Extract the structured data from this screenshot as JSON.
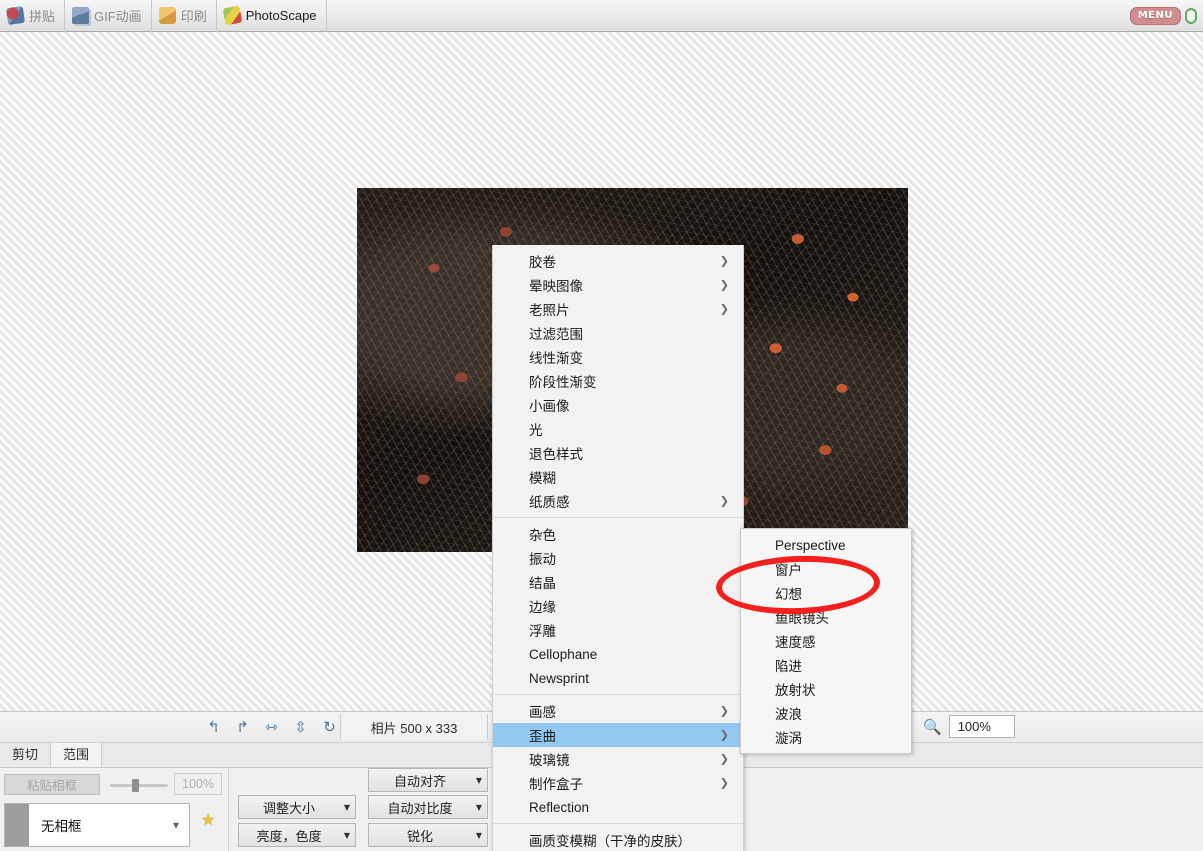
{
  "topbar": {
    "tabs": [
      {
        "label": "拼贴",
        "icon": "collage-icon",
        "active": false
      },
      {
        "label": "GIF动画",
        "icon": "gif-icon",
        "active": false
      },
      {
        "label": "印刷",
        "icon": "print-icon",
        "active": false
      },
      {
        "label": "PhotoScape",
        "icon": "photoscape-icon",
        "active": true
      }
    ],
    "menu_button": "MENU"
  },
  "canvas": {
    "photo_alt": "fishing-nets-and-floats-photo"
  },
  "toolbar": {
    "icons": [
      {
        "name": "undo-icon",
        "glyph": "↰"
      },
      {
        "name": "redo-icon",
        "glyph": "↱"
      },
      {
        "name": "flip-horizontal-icon",
        "glyph": "⇿"
      },
      {
        "name": "flip-vertical-icon",
        "glyph": "⇳"
      },
      {
        "name": "rotate-icon",
        "glyph": "↻"
      }
    ],
    "size_label": "相片 500 x 333",
    "zoom_icon": "zoom-icon",
    "zoom_value": "100%"
  },
  "subtabs": [
    {
      "label": "剪切",
      "active": false
    },
    {
      "label": "范围",
      "active": true
    }
  ],
  "panel": {
    "paste_frame_button": "粘贴相框",
    "slider_percent": "100%",
    "frame_select_value": "无相框",
    "favorite_icon": "star-icon",
    "buttons": [
      {
        "label": "调整大小",
        "dropdown": true
      },
      {
        "label": "亮度，色度",
        "dropdown": true
      },
      {
        "label": "自动对齐",
        "dropdown": true
      },
      {
        "label": "自动对比度",
        "dropdown": true
      },
      {
        "label": "锐化",
        "dropdown": true
      }
    ]
  },
  "context_menu": {
    "items": [
      {
        "label": "胶卷",
        "submenu": true,
        "highlighted": false
      },
      {
        "label": "晕映图像",
        "submenu": true,
        "highlighted": false
      },
      {
        "label": "老照片",
        "submenu": true,
        "highlighted": false
      },
      {
        "label": "过滤范围",
        "submenu": false,
        "highlighted": false
      },
      {
        "label": "线性渐变",
        "submenu": false,
        "highlighted": false
      },
      {
        "label": "阶段性渐变",
        "submenu": false,
        "highlighted": false
      },
      {
        "label": "小画像",
        "submenu": false,
        "highlighted": false
      },
      {
        "label": "光",
        "submenu": false,
        "highlighted": false
      },
      {
        "label": "退色样式",
        "submenu": false,
        "highlighted": false
      },
      {
        "label": "模糊",
        "submenu": false,
        "highlighted": false
      },
      {
        "label": "纸质感",
        "submenu": true,
        "highlighted": false
      },
      {
        "separator": true
      },
      {
        "label": "杂色",
        "submenu": false,
        "highlighted": false
      },
      {
        "label": "振动",
        "submenu": false,
        "highlighted": false
      },
      {
        "label": "结晶",
        "submenu": false,
        "highlighted": false
      },
      {
        "label": "边缘",
        "submenu": false,
        "highlighted": false
      },
      {
        "label": "浮雕",
        "submenu": false,
        "highlighted": false
      },
      {
        "label": "Cellophane",
        "submenu": false,
        "highlighted": false
      },
      {
        "label": "Newsprint",
        "submenu": false,
        "highlighted": false
      },
      {
        "separator": true
      },
      {
        "label": "画感",
        "submenu": true,
        "highlighted": false
      },
      {
        "label": "歪曲",
        "submenu": true,
        "highlighted": true
      },
      {
        "label": "玻璃镜",
        "submenu": true,
        "highlighted": false
      },
      {
        "label": "制作盒子",
        "submenu": true,
        "highlighted": false
      },
      {
        "label": "Reflection",
        "submenu": false,
        "highlighted": false
      },
      {
        "separator": true
      },
      {
        "label": "画质变模糊（干净的皮肤）",
        "submenu": false,
        "highlighted": false
      }
    ]
  },
  "submenu": {
    "items": [
      {
        "label": "Perspective"
      },
      {
        "label": "窗户"
      },
      {
        "label": "幻想"
      },
      {
        "label": "鱼眼镜头"
      },
      {
        "label": "速度感"
      },
      {
        "label": "陷进"
      },
      {
        "label": "放射状"
      },
      {
        "label": "波浪"
      },
      {
        "label": "漩涡"
      }
    ]
  },
  "annotation": {
    "shape": "red-ellipse-highlight"
  },
  "colors": {
    "menu_highlight": "#93c9f0",
    "annotation_red": "#f4201e",
    "menu_bg": "#f2f2f2",
    "canvas_bg": "#eeeeee"
  }
}
